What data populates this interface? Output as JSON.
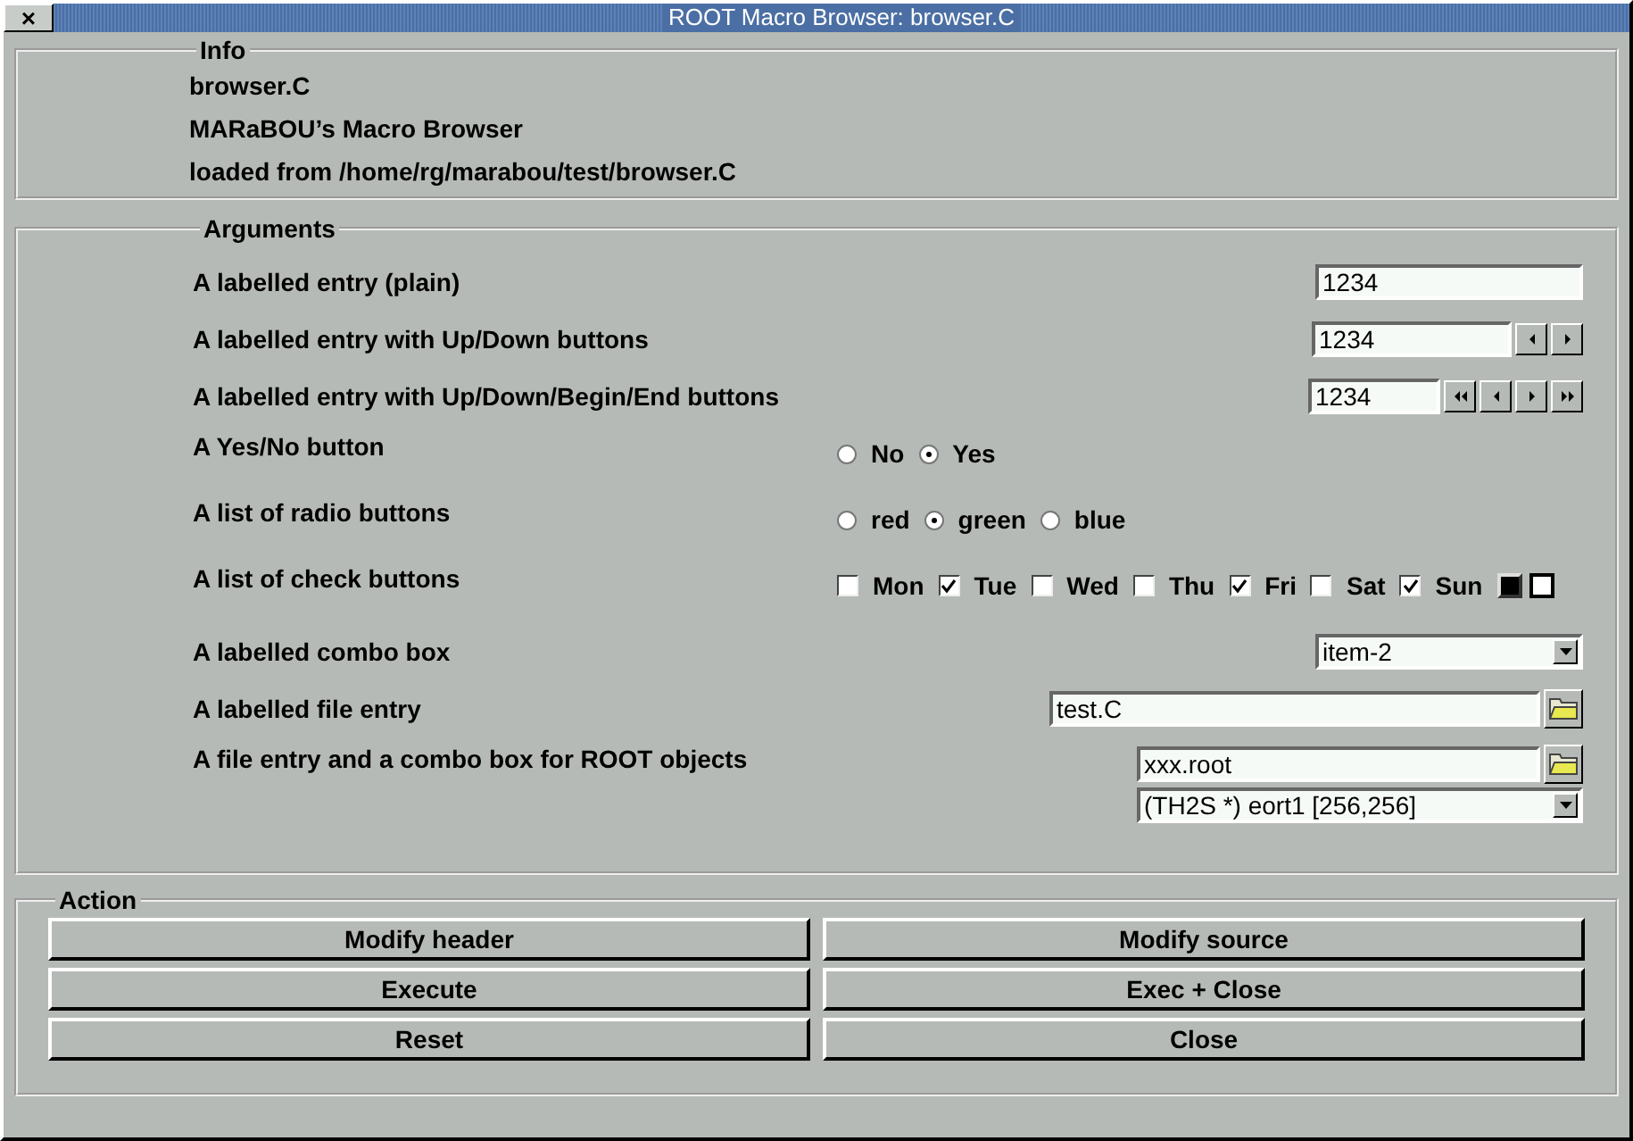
{
  "window": {
    "title": "ROOT Macro Browser: browser.C",
    "close": "×"
  },
  "info": {
    "title": "Info",
    "lines": [
      "browser.C",
      "MARaBOU’s Macro Browser",
      "loaded from /home/rg/marabou/test/browser.C"
    ]
  },
  "arguments": {
    "title": "Arguments",
    "rows": [
      {
        "kind": "entry",
        "label": "A labelled entry (plain)",
        "value": "1234"
      },
      {
        "kind": "spin",
        "label": "A labelled entry with Up/Down buttons",
        "value": "1234"
      },
      {
        "kind": "spin4",
        "label": "A labelled entry with Up/Down/Begin/End buttons",
        "value": "1234"
      },
      {
        "kind": "radio",
        "label": "A Yes/No button",
        "options": [
          {
            "label": "No",
            "selected": false
          },
          {
            "label": "Yes",
            "selected": true
          }
        ]
      },
      {
        "kind": "radio",
        "label": "A list of radio buttons",
        "options": [
          {
            "label": "red",
            "selected": false
          },
          {
            "label": "green",
            "selected": true
          },
          {
            "label": "blue",
            "selected": false
          }
        ]
      },
      {
        "kind": "check",
        "label": "A list of check buttons",
        "options": [
          {
            "label": "Mon",
            "checked": false
          },
          {
            "label": "Tue",
            "checked": true
          },
          {
            "label": "Wed",
            "checked": false
          },
          {
            "label": "Thu",
            "checked": false
          },
          {
            "label": "Fri",
            "checked": true
          },
          {
            "label": "Sat",
            "checked": false
          },
          {
            "label": "Sun",
            "checked": true
          }
        ]
      },
      {
        "kind": "combo",
        "label": "A labelled combo box",
        "value": "item-2"
      },
      {
        "kind": "file",
        "label": "A labelled file entry",
        "value": "test.C"
      },
      {
        "kind": "rootfile",
        "label": "A file entry and a combo box for ROOT objects",
        "value": "xxx.root",
        "object": "(TH2S *) eort1 [256,256]"
      }
    ]
  },
  "action": {
    "title": "Action",
    "buttons": [
      "Modify header",
      "Modify source",
      "Execute",
      "Exec + Close",
      "Reset",
      "Close"
    ]
  }
}
